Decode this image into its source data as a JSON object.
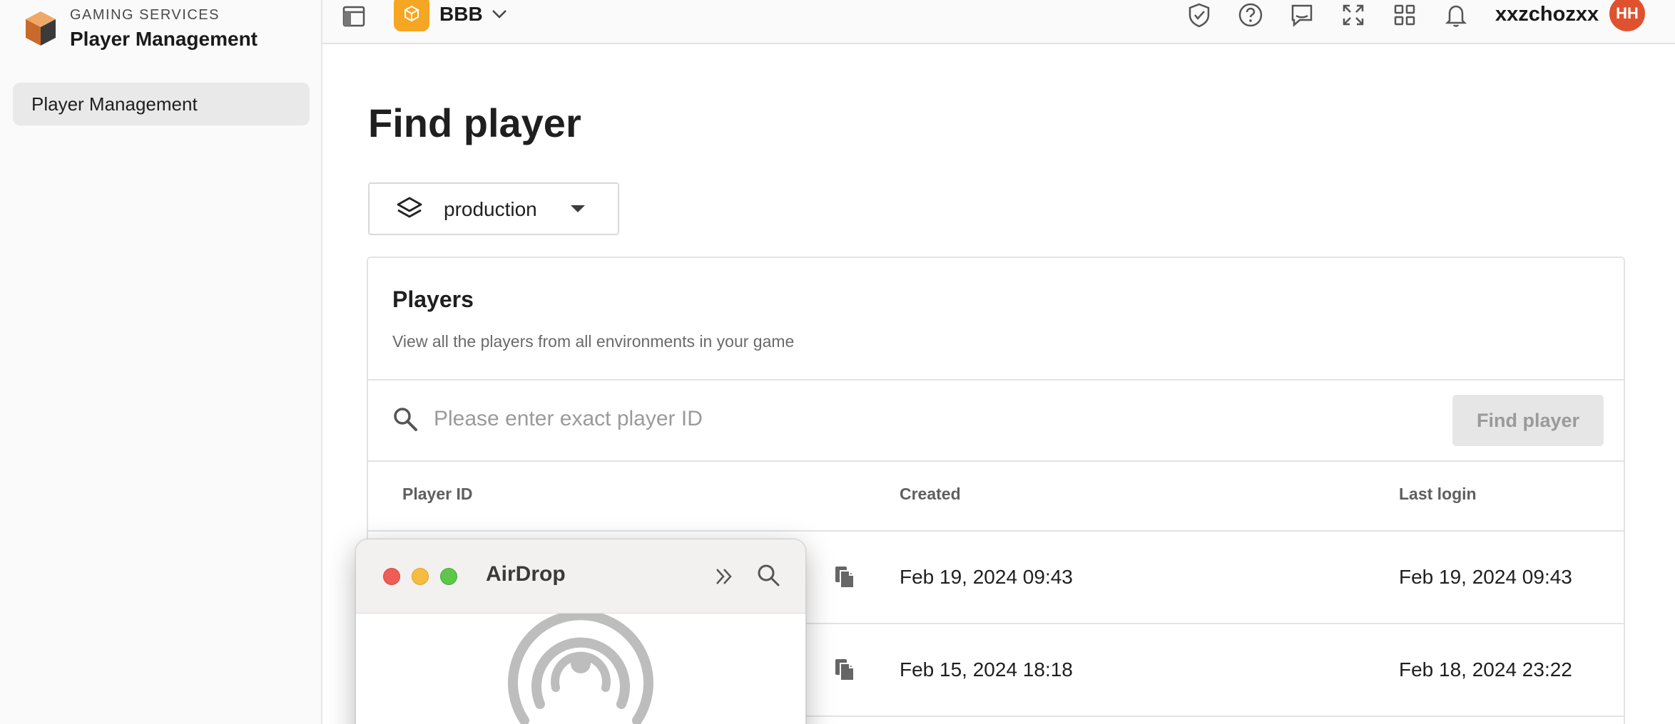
{
  "sidebar": {
    "brand_sub": "GAMING SERVICES",
    "brand_title": "Player Management",
    "items": [
      {
        "label": "Player Management",
        "selected": true
      }
    ]
  },
  "topbar": {
    "project_name": "BBB",
    "username": "xxzchozxx",
    "avatar_initials": "HH",
    "icons": [
      "layout-icon",
      "shield-check-icon",
      "help-icon",
      "feedback-icon",
      "expand-icon",
      "apps-grid-icon",
      "bell-icon"
    ]
  },
  "main": {
    "title": "Find player",
    "environment": "production",
    "card": {
      "title": "Players",
      "subtitle": "View all the players from all environments in your game",
      "search_placeholder": "Please enter exact player ID",
      "find_button": "Find player",
      "columns": [
        "Player ID",
        "Created",
        "Last login"
      ],
      "rows": [
        {
          "created": "Feb 19, 2024 09:43",
          "last_login": "Feb 19, 2024 09:43"
        },
        {
          "created": "Feb 15, 2024 18:18",
          "last_login": "Feb 18, 2024 23:22"
        }
      ]
    }
  },
  "airdrop": {
    "title": "AirDrop"
  },
  "colors": {
    "accent_orange": "#f5a623",
    "avatar": "#e0522f",
    "selected_nav": "#e9e9e9",
    "button_disabled": "#e6e6e6"
  }
}
